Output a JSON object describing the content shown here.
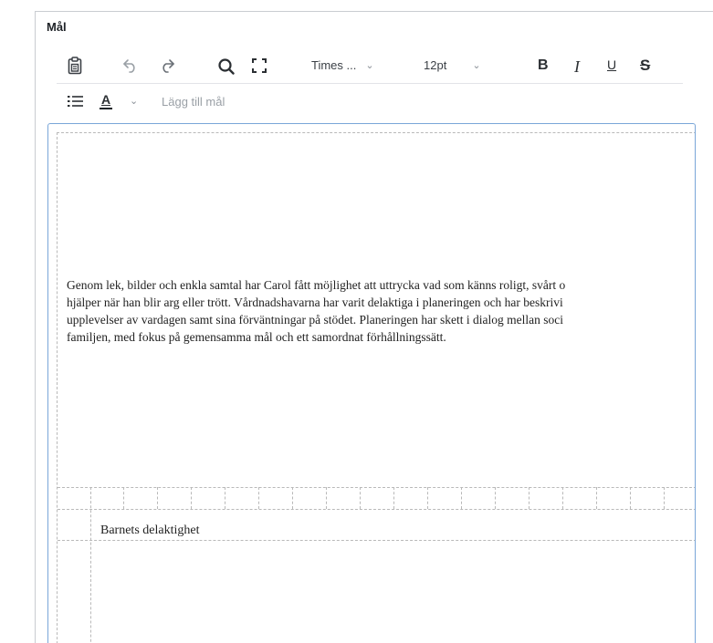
{
  "field": {
    "label": "Mål"
  },
  "toolbar": {
    "row1": [
      {
        "icon": "paste-icon"
      },
      {
        "icon": "undo-icon"
      },
      {
        "icon": "redo-icon"
      },
      {
        "icon": "search-icon"
      },
      {
        "icon": "fullscreen-icon"
      }
    ],
    "font_family": "Times ...",
    "font_size": "12pt",
    "bold_label": "B",
    "italic_label": "I",
    "underline_label": "U",
    "strikethrough_label": "S",
    "text_color_label": "A",
    "text_color_swatch": "#1f2328",
    "add_goal_label": "Lägg till mål"
  },
  "editor": {
    "border_color": "#7aa6d8",
    "paragraph_lines": [
      "Genom lek, bilder och enkla samtal har Carol fått möjlighet att uttrycka vad som känns roligt, svårt o",
      "hjälper när han blir arg eller trött. Vårdnadshavarna har varit delaktiga i planeringen och har beskrivi",
      "upplevelser av vardagen samt sina förväntningar på stödet. Planeringen har skett i dialog mellan soci",
      "familjen, med fokus på gemensamma mål och ett samordnat förhållningssätt."
    ],
    "section_heading": "Barnets delaktighet"
  }
}
